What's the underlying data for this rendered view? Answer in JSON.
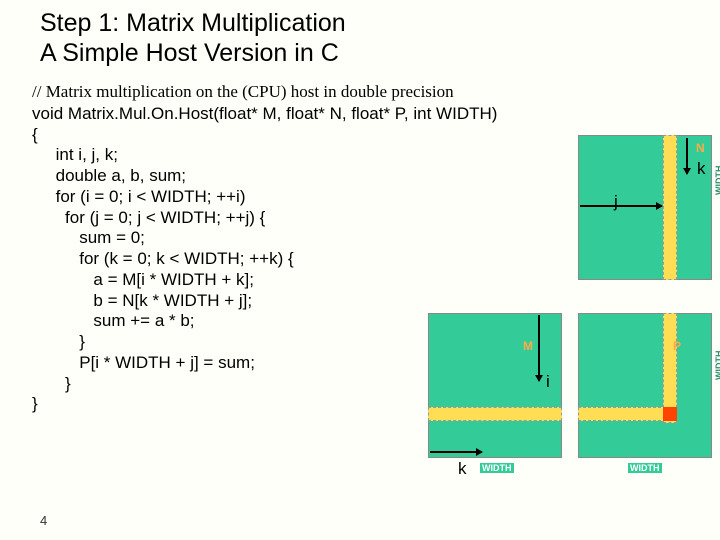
{
  "title": {
    "line1": "Step 1: Matrix Multiplication",
    "line2": "A Simple Host Version in C"
  },
  "comment": "// Matrix multiplication on the (CPU) host in double precision",
  "code": "void Matrix.Mul.On.Host(float* M, float* N, float* P, int WIDTH)\n{\n     int i, j, k;\n     double a, b, sum;\n     for (i = 0; i < WIDTH; ++i)\n       for (j = 0; j < WIDTH; ++j) {\n          sum = 0;\n          for (k = 0; k < WIDTH; ++k) {\n             a = M[i * WIDTH + k];\n             b = N[k * WIDTH + j];\n             sum += a * b;\n          }\n          P[i * WIDTH + j] = sum;\n       }\n}",
  "page": "4",
  "diagram": {
    "matrices": {
      "N": "N",
      "M": "M",
      "P": "P"
    },
    "axes": {
      "i": "i",
      "j": "j",
      "k": "k"
    },
    "width_label": "WIDTH"
  }
}
